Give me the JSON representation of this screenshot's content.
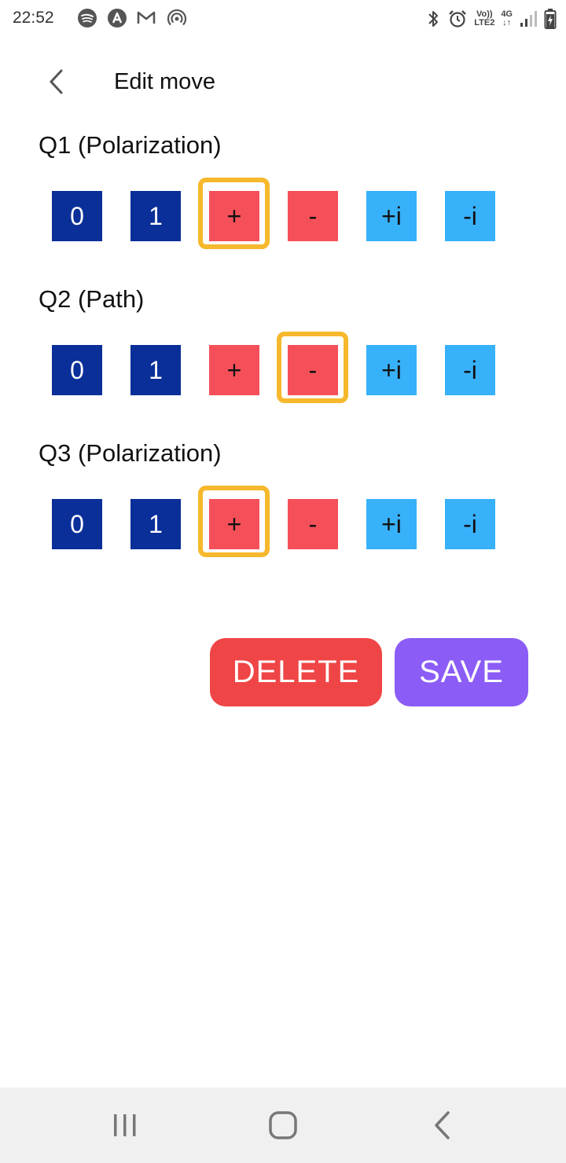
{
  "status_bar": {
    "time": "22:52",
    "notification_icons": [
      "spotify-icon",
      "arc-icon",
      "gmail-icon",
      "hotspot-icon"
    ],
    "volte_top": "Vo))",
    "volte_bottom": "LTE2",
    "network": "4G",
    "right_icons": [
      "bluetooth-icon",
      "alarm-icon",
      "signal-icon",
      "battery-charging-icon"
    ]
  },
  "header": {
    "back_icon": "chevron-left-icon",
    "title": "Edit move"
  },
  "qubits": [
    {
      "label": "Q1 (Polarization)",
      "selected": "+",
      "states": [
        "0",
        "1",
        "+",
        "-",
        "+i",
        "-i"
      ]
    },
    {
      "label": "Q2 (Path)",
      "selected": "-",
      "states": [
        "0",
        "1",
        "+",
        "-",
        "+i",
        "-i"
      ]
    },
    {
      "label": "Q3 (Polarization)",
      "selected": "+",
      "states": [
        "0",
        "1",
        "+",
        "-",
        "+i",
        "-i"
      ]
    }
  ],
  "colors": {
    "basis_z": "#0a2f99",
    "basis_x": "#f5505a",
    "basis_y": "#38b1fb",
    "selection_ring": "#f6b82c",
    "delete": "#ef4546",
    "save": "#8b5cf6"
  },
  "actions": {
    "delete_label": "DELETE",
    "save_label": "SAVE"
  },
  "nav_bar": {
    "icons": [
      "recent-apps-icon",
      "home-icon",
      "back-icon"
    ]
  }
}
